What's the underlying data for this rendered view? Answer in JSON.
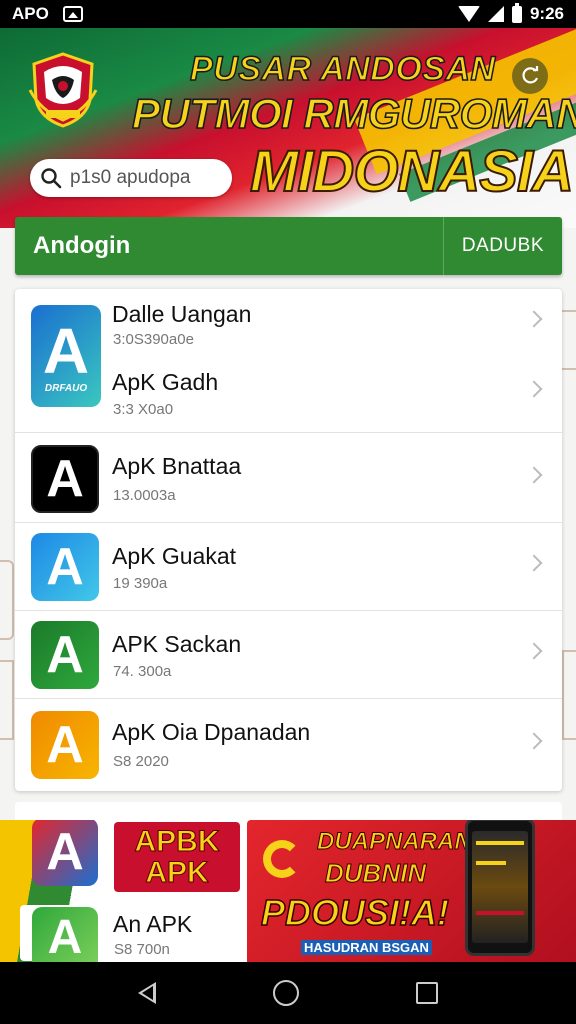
{
  "status_bar": {
    "left_text": "APO",
    "time": "9:26"
  },
  "header": {
    "title_line1": "PUSAR ANDOSAN",
    "title_line2": "PUTMOI RMGUROMAN",
    "title_line3": "MIDONASIA",
    "search_placeholder": "p1s0 apudopa",
    "icons": {
      "emblem": "garuda-emblem-icon",
      "refresh": "refresh-icon",
      "search": "search-icon"
    }
  },
  "section": {
    "title": "Andogin",
    "action_label": "DADUBK"
  },
  "apps": [
    {
      "name": "Dalle Uangan",
      "size": "3:0S390a0e",
      "icon_letter": "A",
      "icon_label": "DRFAUO",
      "colors": [
        "#1a6fd0",
        "#3ac7c0"
      ]
    },
    {
      "name": "ApK Gadh",
      "size": "3:3 X0a0",
      "icon_letter": "",
      "icon_label": "",
      "colors": [
        "#1a6fd0",
        "#3ac7c0"
      ]
    },
    {
      "name": "ApK Bnattaa",
      "size": "13.0003a",
      "icon_letter": "A",
      "icon_label": "",
      "colors": [
        "#000000",
        "#000000"
      ]
    },
    {
      "name": "ApK Guakat",
      "size": "19 390a",
      "icon_letter": "A",
      "icon_label": "",
      "colors": [
        "#1e88e5",
        "#41c8e8"
      ]
    },
    {
      "name": "APK Sackan",
      "size": "74. 300a",
      "icon_letter": "A",
      "icon_label": "",
      "colors": [
        "#1b7a2a",
        "#2fa83c"
      ]
    },
    {
      "name": "ApK Oia Dpanadan",
      "size": "S8 2020",
      "icon_letter": "A",
      "icon_label": "",
      "colors": [
        "#f08a00",
        "#f7b500"
      ]
    }
  ],
  "promo": {
    "badge_line1": "APBK",
    "badge_line2": "APK",
    "banner_line1": "DUAPNARAN",
    "banner_line2": "DUBNIN",
    "banner_line3": "PDOUSI!A!",
    "banner_footer": "HASUDRAN BSGAN"
  },
  "bottom_app": {
    "name": "An APK",
    "size": "S8 700n"
  },
  "nav": {
    "icons": [
      "back-icon",
      "home-icon",
      "recents-icon"
    ]
  }
}
